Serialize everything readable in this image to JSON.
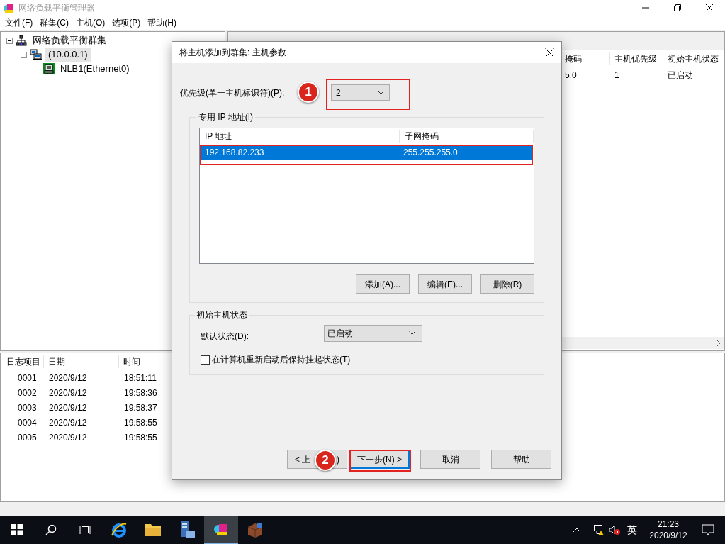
{
  "window": {
    "title": "网络负载平衡管理器"
  },
  "menu": [
    "文件(F)",
    "群集(C)",
    "主机(O)",
    "选项(P)",
    "帮助(H)"
  ],
  "tree": [
    {
      "label": "网络负载平衡群集",
      "kind": "cluster-group",
      "expanded": true,
      "selected": false,
      "children": [
        {
          "label": "(10.0.0.1)",
          "kind": "cluster",
          "expanded": true,
          "selected": true,
          "children": [
            {
              "label": "NLB1(Ethernet0)",
              "kind": "host",
              "selected": false
            }
          ]
        }
      ]
    }
  ],
  "host_pane": {
    "columns": [
      "掩码",
      "主机优先级",
      "初始主机状态"
    ],
    "rows": [
      [
        "5.0",
        "1",
        "已启动"
      ]
    ]
  },
  "log": {
    "columns": [
      "日志项目",
      "日期",
      "时间"
    ],
    "rows": [
      [
        "0001",
        "2020/9/12",
        "18:51:11"
      ],
      [
        "0002",
        "2020/9/12",
        "19:58:36"
      ],
      [
        "0003",
        "2020/9/12",
        "19:58:37"
      ],
      [
        "0004",
        "2020/9/12",
        "19:58:55"
      ],
      [
        "0005",
        "2020/9/12",
        "19:58:55"
      ]
    ]
  },
  "dialog": {
    "title": "将主机添加到群集: 主机参数",
    "priority": {
      "label": "优先级(单一主机标识符)(P):",
      "value": "2"
    },
    "ip_group": {
      "legend": "专用 IP 地址(I)",
      "columns": [
        "IP 地址",
        "子网掩码"
      ],
      "rows": [
        {
          "cells": [
            "192.168.82.233",
            "255.255.255.0"
          ],
          "selected": true
        }
      ],
      "buttons": [
        "添加(A)...",
        "编辑(E)...",
        "删除(R)"
      ]
    },
    "state_group": {
      "legend": "初始主机状态",
      "label": "默认状态(D):",
      "value": "已启动",
      "checkbox": {
        "label": "在计算机重新启动后保持挂起状态(T)",
        "checked": false
      }
    },
    "back_button": [
      "< 上",
      ")"
    ],
    "buttons": [
      {
        "label": "下一步(N) >",
        "selected": true
      },
      {
        "label": "取消",
        "selected": false
      },
      {
        "label": "帮助",
        "selected": false
      }
    ]
  },
  "annotations": [
    "1",
    "2"
  ],
  "taskbar": {
    "apps": [
      {
        "kind": "ie",
        "selected": false
      },
      {
        "kind": "folder",
        "selected": false
      },
      {
        "kind": "server",
        "selected": false
      },
      {
        "kind": "nlb",
        "selected": true
      },
      {
        "kind": "box",
        "selected": false
      }
    ],
    "ime": "英",
    "time": "21:23",
    "date": "2020/9/12"
  }
}
